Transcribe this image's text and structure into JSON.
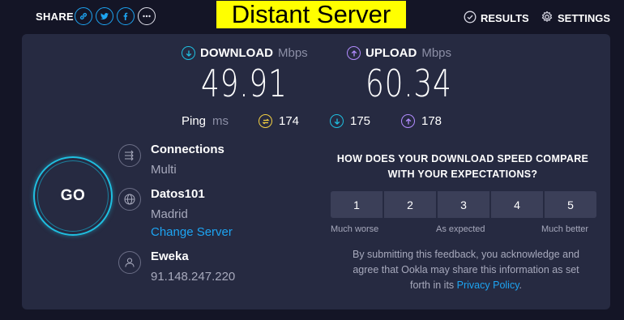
{
  "header": {
    "share_label": "SHARE",
    "share_icons": [
      "link-icon",
      "twitter-icon",
      "facebook-icon",
      "more-icon"
    ],
    "title": "Distant Server",
    "results_label": "RESULTS",
    "settings_label": "SETTINGS"
  },
  "download": {
    "label": "DOWNLOAD",
    "unit": "Mbps",
    "value": "49.91",
    "color": "#1fbfe0"
  },
  "upload": {
    "label": "UPLOAD",
    "unit": "Mbps",
    "value": "60.34",
    "color": "#b28cff"
  },
  "ping": {
    "label": "Ping",
    "unit": "ms",
    "idle": "174",
    "download": "175",
    "upload": "178",
    "idle_color": "#f5d142"
  },
  "go_button": {
    "label": "GO"
  },
  "connections": {
    "title": "Connections",
    "value": "Multi"
  },
  "server": {
    "name": "Datos101",
    "location": "Madrid",
    "change_label": "Change Server"
  },
  "provider": {
    "name": "Eweka",
    "ip": "91.148.247.220"
  },
  "feedback": {
    "question_line1": "HOW DOES YOUR DOWNLOAD SPEED COMPARE",
    "question_line2": "WITH YOUR EXPECTATIONS?",
    "ratings": [
      "1",
      "2",
      "3",
      "4",
      "5"
    ],
    "scale_low": "Much worse",
    "scale_mid": "As expected",
    "scale_high": "Much better",
    "note_line1": "By submitting this feedback, you acknowledge and",
    "note_line2": "agree that Ookla may share this information as set",
    "note_line3_prefix": "forth in its",
    "privacy_link": "Privacy Policy",
    "note_line3_suffix": "."
  }
}
